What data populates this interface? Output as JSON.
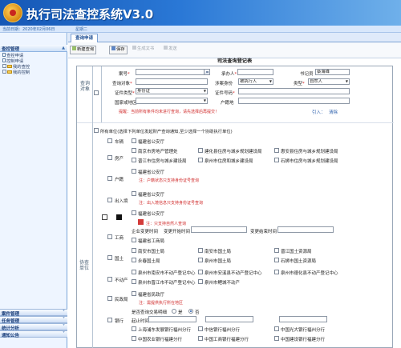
{
  "app": {
    "title": "执行司法查控系统V3.0",
    "date": "当前日期：2020年02月06日",
    "weekday": "星期二"
  },
  "sidebar": {
    "top_title": "查控管理",
    "items": [
      "查控申请",
      "控制申请",
      "我的查控",
      "我的控制"
    ],
    "bottom": [
      "案件管理",
      "任务管理",
      "统计分析",
      "通知公告"
    ]
  },
  "tab": {
    "label": "查询申请"
  },
  "toolbar": {
    "buttons": [
      "新建查询",
      "保存",
      "生成文书",
      "发送"
    ]
  },
  "form": {
    "title": "司法查询登记表",
    "case": {
      "side": "查询对象",
      "case_no": "案号",
      "judge": "承办人",
      "clerk": "书记员",
      "clerk_value": "蔡海峰",
      "target": "查询对象",
      "party_role": "涉案身份",
      "party_role_value": "被执行人",
      "type": "类型",
      "type_value": "自然人",
      "cert_type": "证件类型",
      "cert_type_value": "身份证",
      "cert_no": "证件号码",
      "country": "国家或地区",
      "domicile": "户籍地",
      "tip": "提醒：当前所有条件均未进行查询，请先选择后再提交！",
      "import": "引入：",
      "import_value": "清除"
    },
    "coop": {
      "side": "协查单位",
      "all": "所有单位(选择下列单位发起财产查询通知,至少选择一个协助执行单位)",
      "vehicle": "车辆",
      "housing": "房产",
      "household": "户籍",
      "exit": "出入境",
      "business": "工商",
      "land": "国土",
      "realty": "不动产",
      "civil": "民政局",
      "bank": "银行"
    },
    "checks": {
      "vehicle": [
        "福建省公安厅"
      ],
      "housing": [
        "南京市房地产管理处",
        "建化县住房与城乡规划建设局",
        "惠安县住房与城乡规划建设局",
        "晋江市住房与城乡建设局",
        "泉州市住房和城乡建设局",
        "石狮市住房与城乡规划建设局"
      ],
      "household": [
        "福建省公安厅",
        "注：户籍状态只支持身份证号查询"
      ],
      "exit": [
        "福建省公安厅",
        "注：出入境信息只支持身份证号查询"
      ],
      "extra": [
        "福建省公安厅",
        "注：只支持自然人查询"
      ],
      "business_time": "企业变更时间",
      "business_start": "变更开始时间",
      "business_end": "变更结束时间",
      "business_office": "福建省工商局",
      "land": [
        "南安市国土局",
        "南安市国土局",
        "晋江国土资源局",
        "永春国土局",
        "泉州市国土局",
        "石狮市国土资源局"
      ],
      "realty": [
        "泉州市南安市不动产登记中心",
        "泉州市安溪县不动产登记中心",
        "泉州市德化县不动产登记中心",
        "泉州市晋江市不动产登记中心",
        "泉州市鲤城不动产"
      ],
      "civil": [
        "福建省民政厅",
        "注：需提供执行所在地区"
      ],
      "bank_head": "是否查询交易明细",
      "bank_yes": "是",
      "bank_no": "否",
      "bank_time": "起止时间",
      "bank_items": [
        "上海浦东发展银行福州分行",
        "中信银行福州分行",
        "中国光大银行福州分行",
        "中国农业银行福建分行",
        "中国工商银行福建分行",
        "中国建设银行福建分行"
      ]
    }
  }
}
